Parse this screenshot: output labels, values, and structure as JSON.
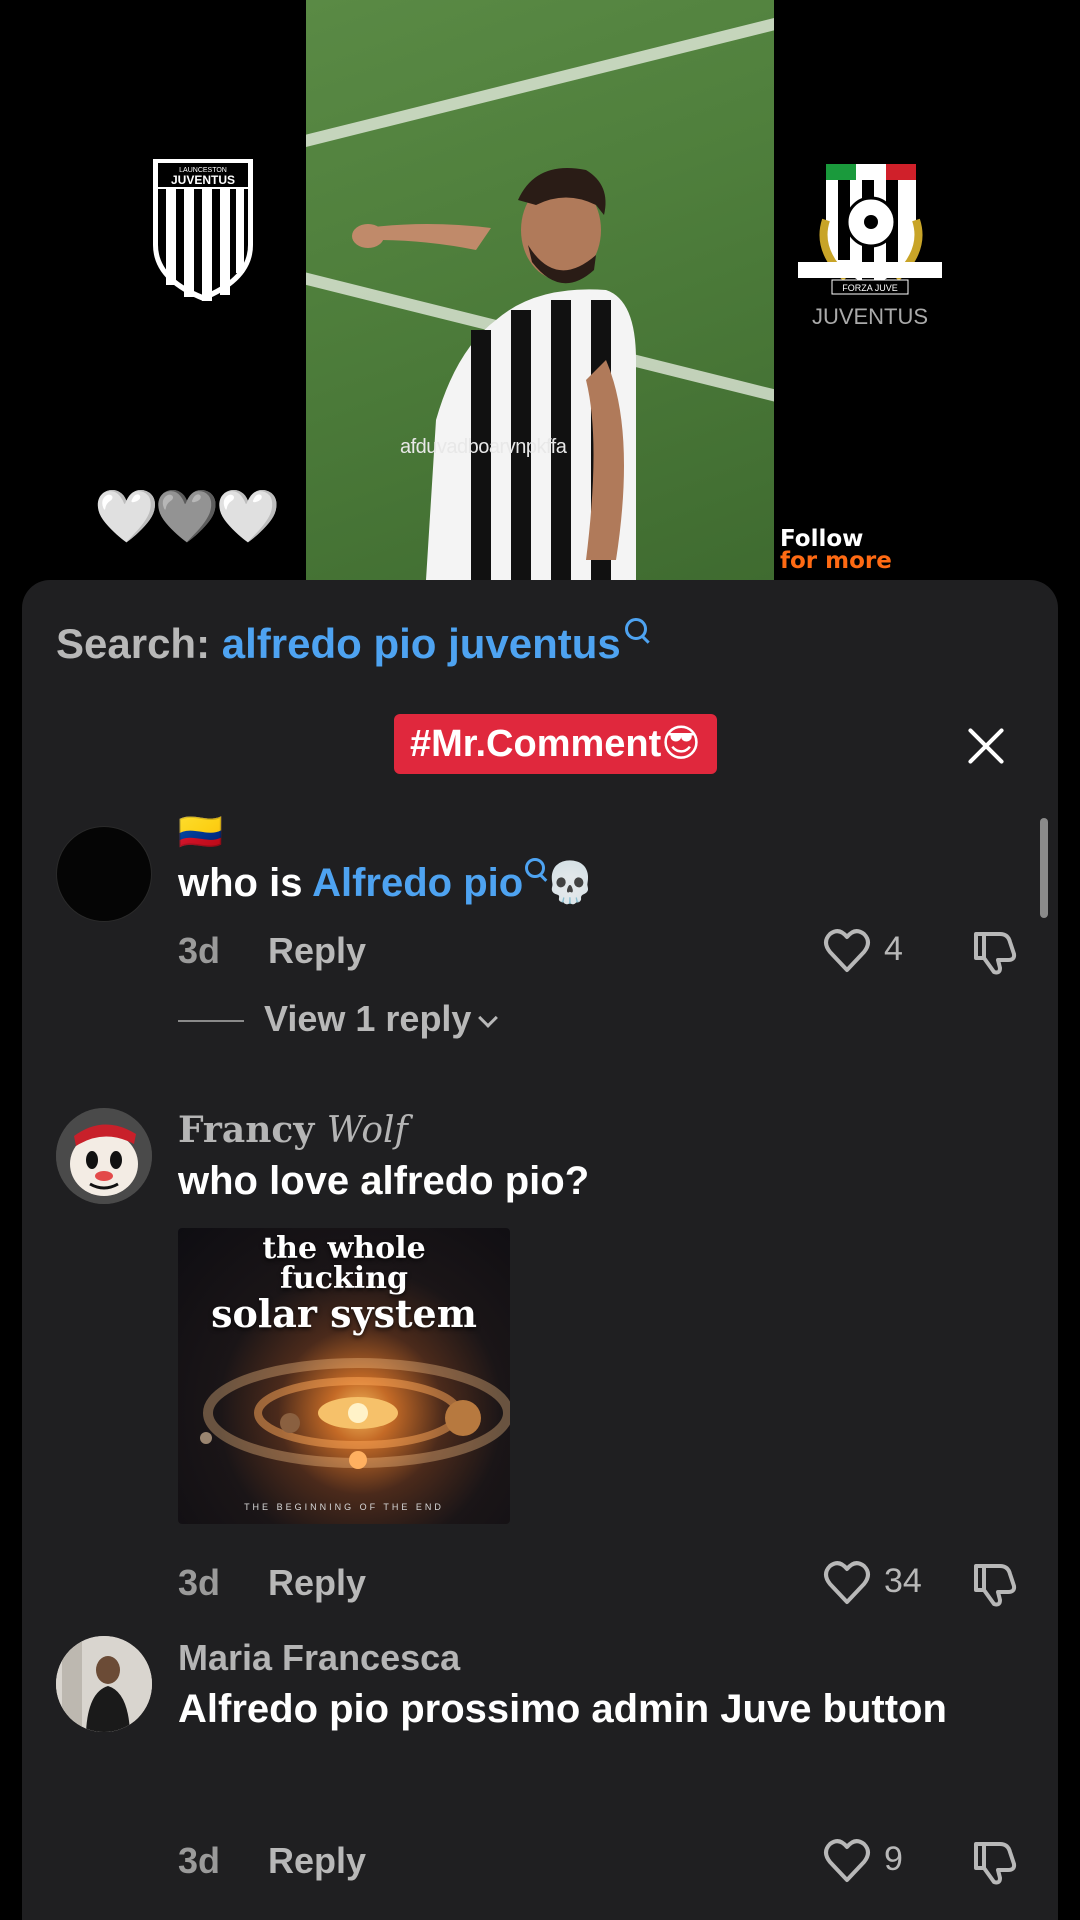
{
  "video": {
    "watermark": "afduvadboarvnpkffa",
    "left_crest_text": "LAUNCESTON JUVENTUS",
    "right_crest_text": "FORZA JUVE",
    "hearts": "🤍🩶🤍",
    "follow_line1": "Follow",
    "follow_line2": "for more"
  },
  "sheet": {
    "search_label": "Search: ",
    "search_term": "alfredo pio juventus",
    "tag": "#Mr.Comment😎"
  },
  "comments": [
    {
      "username": "🇨🇴",
      "text_prefix": "who is ",
      "text_link": "Alfredo pio",
      "text_suffix": "💀",
      "time": "3d",
      "reply_label": "Reply",
      "likes": "4",
      "view_replies": "View 1 reply"
    },
    {
      "username_first": "Francy",
      "username_second": "Wolf",
      "text": "who love alfredo pio?",
      "gif_line1": "the whole",
      "gif_line2": "fucking",
      "gif_line3": "solar system",
      "gif_footer": "THE BEGINNING OF THE END",
      "time": "3d",
      "reply_label": "Reply",
      "likes": "34"
    },
    {
      "username": "Maria Francesca",
      "text": "Alfredo pio prossimo admin Juve button",
      "time": "3d",
      "reply_label": "Reply",
      "likes": "9"
    }
  ],
  "colors": {
    "link": "#4ea3f1",
    "tag_bg": "#e0283d",
    "sheet_bg": "#1f1f21",
    "follow_accent": "#ff6a13"
  }
}
